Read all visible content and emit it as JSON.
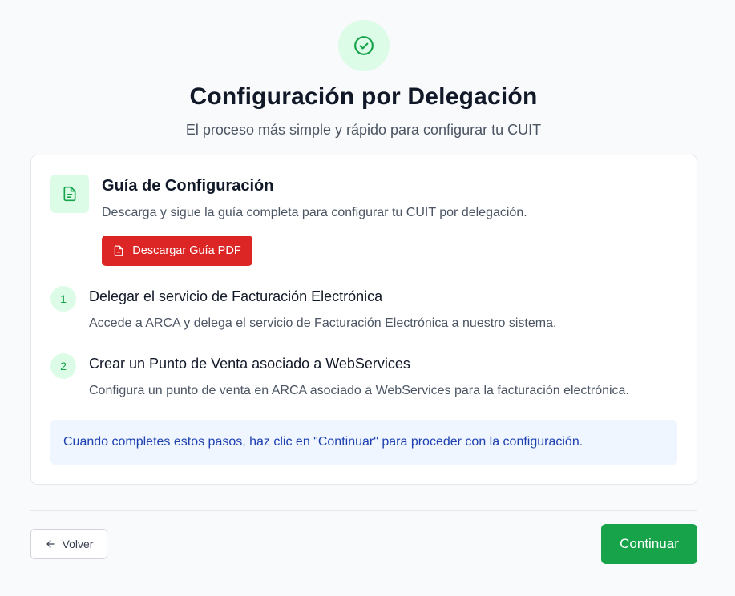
{
  "header": {
    "icon": "check-circle-icon",
    "title": "Configuración por Delegación",
    "subtitle": "El proceso más simple y rápido para configurar tu CUIT"
  },
  "guide": {
    "icon": "document-icon",
    "title": "Guía de Configuración",
    "description": "Descarga y sigue la guía completa para configurar tu CUIT por delegación.",
    "download_label": "Descargar Guía PDF",
    "download_icon": "pdf-file-icon"
  },
  "steps": [
    {
      "number": "1",
      "title": "Delegar el servicio de Facturación Electrónica",
      "description": "Accede a ARCA y delega el servicio de Facturación Electrónica a nuestro sistema."
    },
    {
      "number": "2",
      "title": "Crear un Punto de Venta asociado a WebServices",
      "description": "Configura un punto de venta en ARCA asociado a WebServices para la facturación electrónica."
    }
  ],
  "info": {
    "text": "Cuando completes estos pasos, haz clic en \"Continuar\" para proceder con la configuración."
  },
  "footer": {
    "back_label": "Volver",
    "back_icon": "arrow-left-icon",
    "continue_label": "Continuar"
  },
  "colors": {
    "accent_green": "#16a34a",
    "light_green": "#dcfce7",
    "pdf_red": "#dc2626",
    "info_bg": "#eff6ff",
    "info_text": "#1e40af"
  }
}
